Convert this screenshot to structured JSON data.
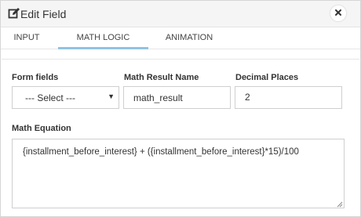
{
  "dialog": {
    "title": "Edit Field"
  },
  "tabs": [
    {
      "label": "INPUT"
    },
    {
      "label": "MATH LOGIC"
    },
    {
      "label": "ANIMATION"
    }
  ],
  "active_tab": "MATH LOGIC",
  "form": {
    "form_fields": {
      "label": "Form fields",
      "value": "--- Select ---"
    },
    "result_name": {
      "label": "Math Result Name",
      "value": "math_result"
    },
    "decimal_places": {
      "label": "Decimal Places",
      "value": "2"
    },
    "equation": {
      "label": "Math Equation",
      "value": "{installment_before_interest} + ({installment_before_interest}*15)/100"
    }
  },
  "colors": {
    "active_tab_underline": "#8fc4e3",
    "header_bg": "#f5f5f5"
  },
  "icons": {
    "title": "edit-icon",
    "close": "close-icon",
    "dropdown": "caret-down-icon"
  }
}
